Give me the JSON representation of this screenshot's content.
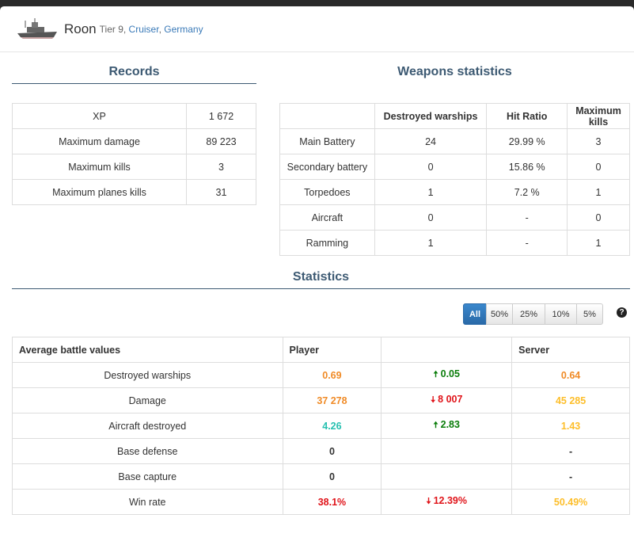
{
  "header": {
    "ship_name": "Roon",
    "tier": "Tier 9,",
    "type": "Cruiser",
    "sep": ",",
    "nation": "Germany"
  },
  "records": {
    "title": "Records",
    "rows": [
      [
        "XP",
        "1 672"
      ],
      [
        "Maximum damage",
        "89 223"
      ],
      [
        "Maximum kills",
        "3"
      ],
      [
        "Maximum planes kills",
        "31"
      ]
    ]
  },
  "weapons": {
    "title": "Weapons statistics",
    "headers": [
      "",
      "Destroyed warships",
      "Hit Ratio",
      "Maximum kills"
    ],
    "rows": [
      [
        "Main Battery",
        "24",
        "29.99 %",
        "3"
      ],
      [
        "Secondary battery",
        "0",
        "15.86 %",
        "0"
      ],
      [
        "Torpedoes",
        "1",
        "7.2 %",
        "1"
      ],
      [
        "Aircraft",
        "0",
        "-",
        "0"
      ],
      [
        "Ramming",
        "1",
        "-",
        "1"
      ]
    ]
  },
  "statistics": {
    "title": "Statistics",
    "filters": [
      "All",
      "50%",
      "25%",
      "10%",
      "5%"
    ],
    "active_filter": "All",
    "help_icon": "question-circle-icon",
    "headers": [
      "Average battle values",
      "Player",
      "",
      "Server"
    ],
    "rows": [
      {
        "label": "Destroyed warships",
        "player": "0.69",
        "player_color": "#f08b27",
        "diff": "0.05",
        "diff_dir": "up",
        "server": "0.64",
        "server_color": "#f08b27"
      },
      {
        "label": "Damage",
        "player": "37 278",
        "player_color": "#f08b27",
        "diff": "8 007",
        "diff_dir": "down",
        "server": "45 285",
        "server_color": "#fdbe2a"
      },
      {
        "label": "Aircraft destroyed",
        "player": "4.26",
        "player_color": "#26c0b0",
        "diff": "2.83",
        "diff_dir": "up",
        "server": "1.43",
        "server_color": "#fdbe2a"
      },
      {
        "label": "Base defense",
        "player": "0",
        "player_color": "#333333",
        "diff": "",
        "diff_dir": "",
        "server": "-",
        "server_color": "#333333"
      },
      {
        "label": "Base capture",
        "player": "0",
        "player_color": "#333333",
        "diff": "",
        "diff_dir": "",
        "server": "-",
        "server_color": "#333333"
      },
      {
        "label": "Win rate",
        "player": "38.1%",
        "player_color": "#e0141a",
        "diff": "12.39%",
        "diff_dir": "down",
        "server": "50.49%",
        "server_color": "#fdbe2a"
      }
    ]
  }
}
